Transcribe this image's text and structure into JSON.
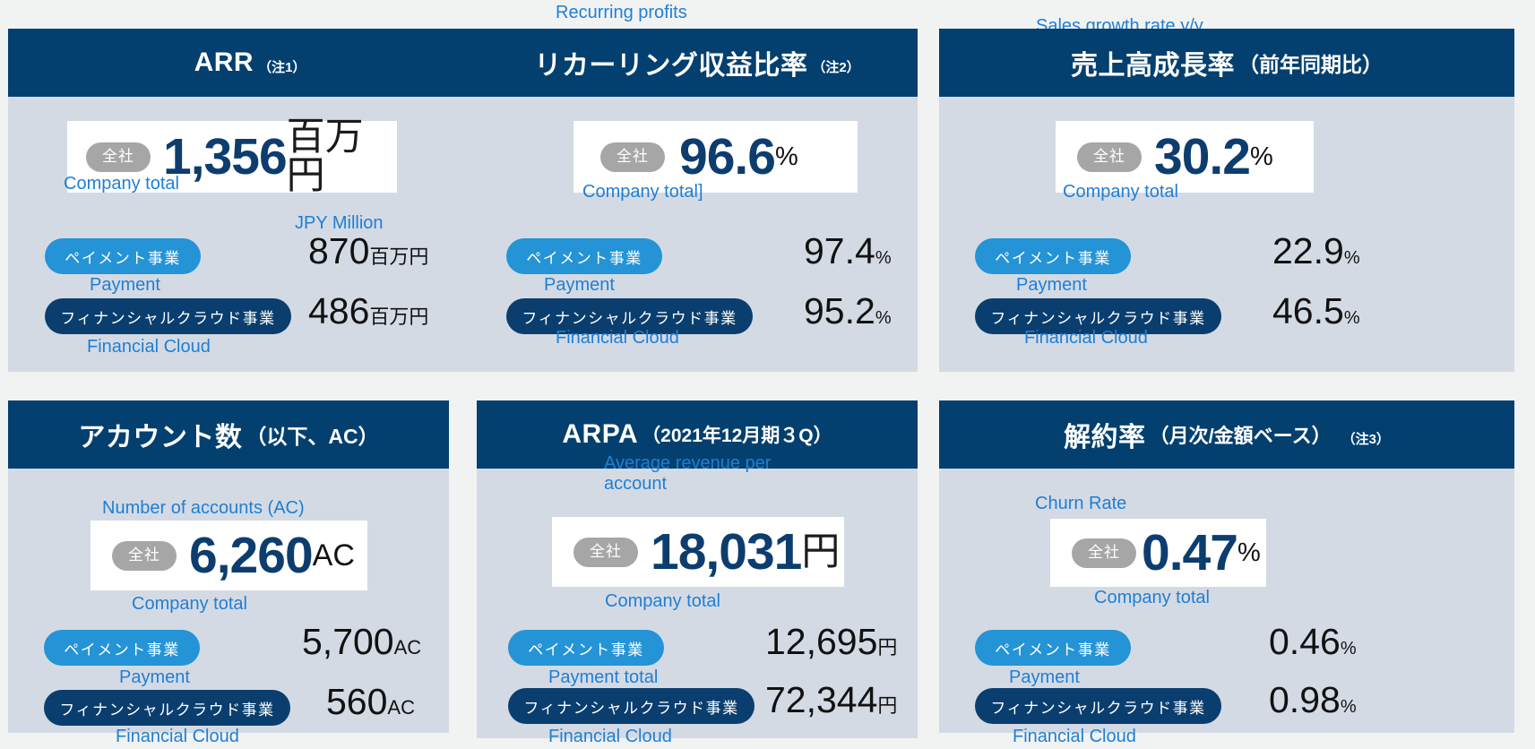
{
  "theme": {
    "page_bg": "#f1f2f2",
    "card_bg": "#d4dae4",
    "header_bg": "#03406f",
    "hero_box_bg": "#ffffff",
    "hero_number": "#0d3d6e",
    "caption_blue": "#1f7fd4",
    "pill_total_bg": "#a6a6a6",
    "pill_payment_bg": "#2494d6",
    "pill_fincloud_bg": "#0a3e6e"
  },
  "labels": {
    "total_pill": "全社",
    "payment_pill": "ペイメント事業",
    "fincloud_pill": "フィナンシャルクラウド事業"
  },
  "cards": [
    {
      "id": "arr",
      "title": "ARR",
      "title_sub": "",
      "title_note": "（注1）",
      "overhead_caption": "",
      "hero_caption": "",
      "hero_value": "1,356",
      "hero_unit": "百万円",
      "hero_unit_caption": "JPY Million",
      "total_caption": "Company total",
      "rows": [
        {
          "pill": "ペイメント事業",
          "caption": "Payment",
          "value": "870",
          "unit": "百万円"
        },
        {
          "pill": "フィナンシャルクラウド事業",
          "caption": "Financial Cloud",
          "value": "486",
          "unit": "百万円"
        }
      ]
    },
    {
      "id": "recurring-ratio",
      "title": "リカーリング収益比率",
      "title_sub": "",
      "title_note": "（注2）",
      "overhead_caption": "Recurring profits",
      "hero_caption": "",
      "hero_value": "96.6",
      "hero_unit": "%",
      "hero_unit_caption": "",
      "total_caption": "Company total]",
      "rows": [
        {
          "pill": "ペイメント事業",
          "caption": "Payment",
          "value": "97.4",
          "unit": "%"
        },
        {
          "pill": "フィナンシャルクラウド事業",
          "caption": "Financial Cloud",
          "value": "95.2",
          "unit": "%"
        }
      ]
    },
    {
      "id": "sales-growth",
      "title": "売上高成長率",
      "title_sub": "（前年同期比）",
      "title_note": "",
      "overhead_caption": "Sales growth rate y/y",
      "hero_caption": "",
      "hero_value": "30.2",
      "hero_unit": "%",
      "hero_unit_caption": "",
      "total_caption": "Company total",
      "rows": [
        {
          "pill": "ペイメント事業",
          "caption": "Payment",
          "value": "22.9",
          "unit": "%"
        },
        {
          "pill": "フィナンシャルクラウド事業",
          "caption": "Financial Cloud",
          "value": "46.5",
          "unit": "%"
        }
      ]
    },
    {
      "id": "accounts",
      "title": "アカウント数",
      "title_sub": "（以下、AC）",
      "title_note": "",
      "overhead_caption": "",
      "hero_caption": "Number of accounts (AC)",
      "hero_value": "6,260",
      "hero_unit": "AC",
      "hero_unit_caption": "",
      "total_caption": "Company total",
      "rows": [
        {
          "pill": "ペイメント事業",
          "caption": "Payment",
          "value": "5,700",
          "unit": "AC"
        },
        {
          "pill": "フィナンシャルクラウド事業",
          "caption": "Financial Cloud",
          "value": "560",
          "unit": "AC"
        }
      ]
    },
    {
      "id": "arpa",
      "title": "ARPA",
      "title_sub": "（2021年12月期３Q）",
      "title_note": "",
      "overhead_caption": "",
      "hero_caption": "Average revenue per account",
      "hero_value": "18,031",
      "hero_unit": "円",
      "hero_unit_caption": "",
      "total_caption": "Company total",
      "rows": [
        {
          "pill": "ペイメント事業",
          "caption": "Payment total",
          "value": "12,695",
          "unit": "円"
        },
        {
          "pill": "フィナンシャルクラウド事業",
          "caption": "Financial Cloud",
          "value": "72,344",
          "unit": "円"
        }
      ]
    },
    {
      "id": "churn",
      "title": "解約率",
      "title_sub": "（月次/金額ベース）",
      "title_note": "（注3）",
      "overhead_caption": "",
      "hero_caption": "Churn Rate",
      "hero_value": "0.47",
      "hero_unit": "%",
      "hero_unit_caption": "",
      "total_caption": "Company total",
      "rows": [
        {
          "pill": "ペイメント事業",
          "caption": "Payment",
          "value": "0.46",
          "unit": "%"
        },
        {
          "pill": "フィナンシャルクラウド事業",
          "caption": "Financial Cloud",
          "value": "0.98",
          "unit": "%"
        }
      ]
    }
  ]
}
